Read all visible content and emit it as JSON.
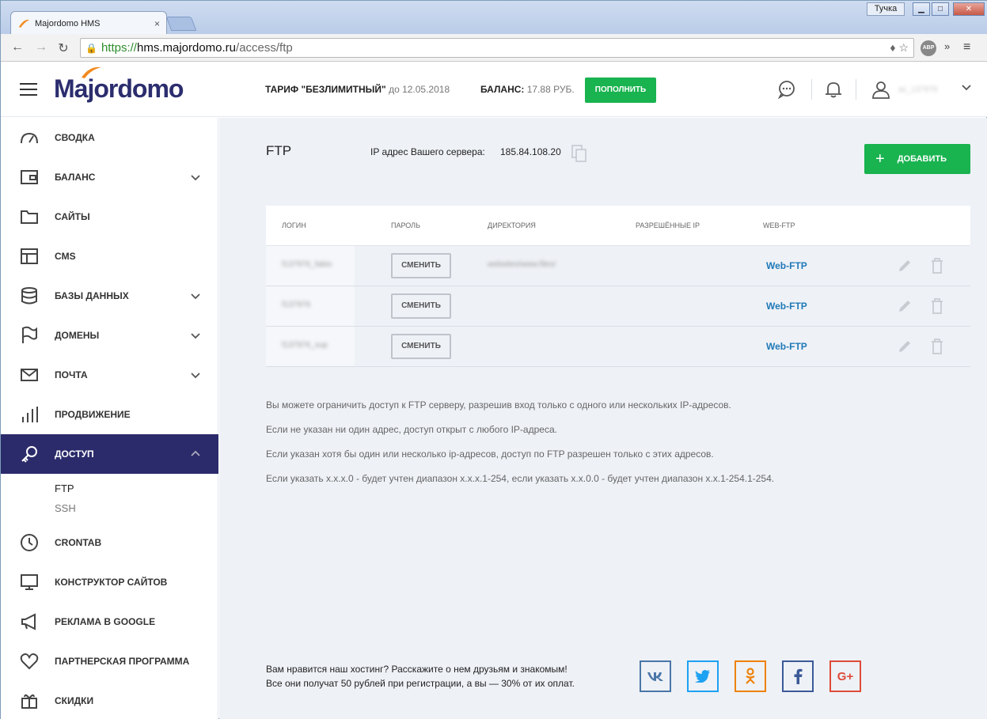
{
  "browser": {
    "tab_title": "Majordomo HMS",
    "tab_close": "×",
    "window_user": "Тучка",
    "min_glyph": "▁",
    "max_glyph": "□",
    "close_glyph": "✕",
    "url_scheme": "https://",
    "url_host": "hms.majordomo.ru",
    "url_path": "/access/ftp",
    "abp_label": "ABP",
    "more_glyph": "»",
    "menu_glyph": "≡",
    "back_glyph": "←",
    "forward_glyph": "→",
    "reload_glyph": "↻",
    "lock_glyph": "🔒",
    "addr_icons": "♦ ☆"
  },
  "header": {
    "logo": "Majordomo",
    "tariff_label": "ТАРИФ \"БЕЗЛИМИТНЫЙ\"",
    "tariff_date": "до 12.05.2018",
    "balance_label": "БАЛАНС:",
    "balance_amount": "17.88 РУБ.",
    "topup_label": "ПОПОЛНИТЬ",
    "user_name": "ac_137976"
  },
  "sidebar": {
    "items": [
      {
        "label": "СВОДКА"
      },
      {
        "label": "БАЛАНС"
      },
      {
        "label": "САЙТЫ"
      },
      {
        "label": "CMS"
      },
      {
        "label": "БАЗЫ ДАННЫХ"
      },
      {
        "label": "ДОМЕНЫ"
      },
      {
        "label": "ПОЧТА"
      },
      {
        "label": "ПРОДВИЖЕНИЕ"
      },
      {
        "label": "ДОСТУП"
      },
      {
        "label": "CRONTAB"
      },
      {
        "label": "КОНСТРУКТОР САЙТОВ"
      },
      {
        "label": "РЕКЛАМА В GOOGLE"
      },
      {
        "label": "ПАРТНЕРСКАЯ ПРОГРАММА"
      },
      {
        "label": "СКИДКИ"
      }
    ],
    "sub_items": [
      {
        "label": "FTP"
      },
      {
        "label": "SSH"
      }
    ]
  },
  "main": {
    "title": "FTP",
    "ip_label": "IP адрес Вашего сервера:",
    "ip_value": "185.84.108.20",
    "add_plus": "+",
    "add_label": "ДОБАВИТЬ",
    "columns": [
      "ЛОГИН",
      "ПАРОЛЬ",
      "ДИРЕКТОРИЯ",
      "РАЗРЕШЁННЫЕ IP",
      "WEB-FTP"
    ],
    "rows": [
      {
        "login": "f137976_fabio",
        "change": "СМЕНИТЬ",
        "dir": "websites/www.files/",
        "webftp": "Web-FTP"
      },
      {
        "login": "f137976",
        "change": "СМЕНИТЬ",
        "dir": "",
        "webftp": "Web-FTP"
      },
      {
        "login": "f137976_sup",
        "change": "СМЕНИТЬ",
        "dir": "",
        "webftp": "Web-FTP"
      }
    ],
    "info": [
      "Вы можете ограничить доступ к FTP серверу, разрешив вход только с одного или нескольких IP-адресов.",
      "Если не указан ни один адрес, доступ открыт с любого IP-адреса.",
      "Если указан хотя бы один или несколько ip-адресов, доступ по FTP разрешен только с этих адресов.",
      "Если указать x.x.x.0 - будет учтен диапазон x.x.x.1-254, если указать x.x.0.0 - будет учтен диапазон x.x.1-254.1-254."
    ]
  },
  "footer": {
    "line1": "Вам нравится наш хостинг? Расскажите о нем друзьям и знакомым!",
    "line2": "Все они получат 50 рублей при регистрации, а вы — 30% от их оплат.",
    "social": [
      {
        "label": "vk",
        "color": "#4a76a8"
      },
      {
        "label": "twitter",
        "color": "#1da1f2"
      },
      {
        "label": "odnoklassniki",
        "color": "#ee8208"
      },
      {
        "label": "facebook",
        "color": "#3b5998"
      },
      {
        "label": "G+",
        "color": "#dd4b39"
      }
    ]
  },
  "colors": {
    "accent_green": "#19b34f",
    "sidebar_active": "#2b2b6b",
    "link_blue": "#1f79b8"
  }
}
